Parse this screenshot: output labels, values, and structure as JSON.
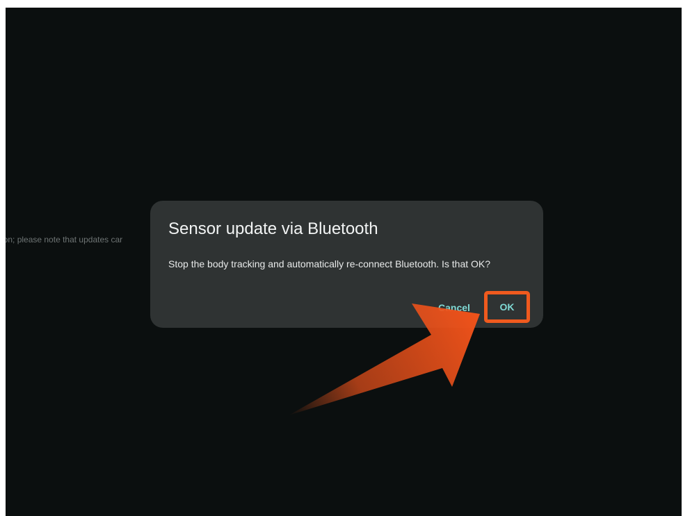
{
  "background": {
    "partial_text": "ection; please note that updates car"
  },
  "dialog": {
    "title": "Sensor update via Bluetooth",
    "message": "Stop the body tracking and automatically re-connect Bluetooth. Is that OK?",
    "cancel_label": "Cancel",
    "ok_label": "OK"
  },
  "colors": {
    "screen_bg": "#0b0f0f",
    "dialog_bg": "#2f3333",
    "button_text": "#7fd9d4",
    "highlight": "#f05a1e"
  },
  "annotation": {
    "highlight_target": "OK",
    "icon": "arrow-pointer-icon"
  }
}
